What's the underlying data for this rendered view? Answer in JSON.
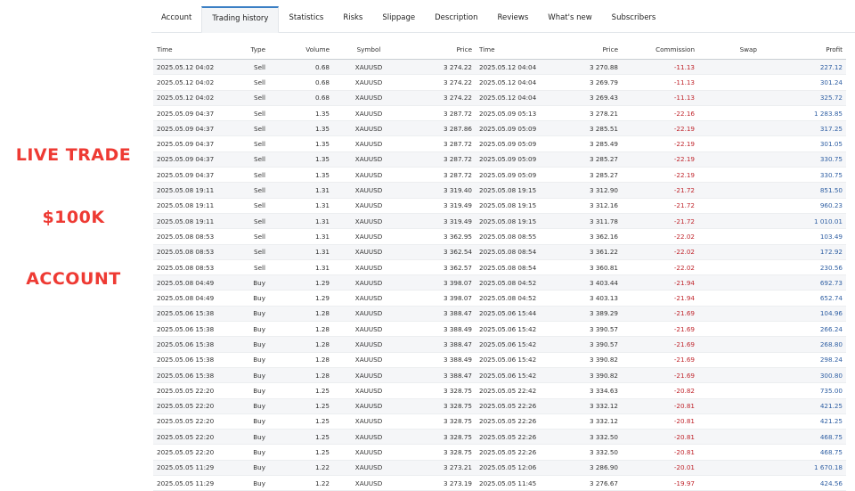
{
  "promo": {
    "line1": "LIVE TRADE",
    "line2": "$100K",
    "line3": "ACCOUNT",
    "color": "#ee3a33"
  },
  "tabs": [
    {
      "label": "Account"
    },
    {
      "label": "Trading history"
    },
    {
      "label": "Statistics"
    },
    {
      "label": "Risks"
    },
    {
      "label": "Slippage"
    },
    {
      "label": "Description"
    },
    {
      "label": "Reviews"
    },
    {
      "label": "What's new"
    },
    {
      "label": "Subscribers"
    }
  ],
  "active_tab": 1,
  "table": {
    "headers": [
      "Time",
      "Type",
      "Volume",
      "Symbol",
      "Price",
      "Time",
      "Price",
      "Commission",
      "Swap",
      "Profit"
    ],
    "rows": [
      [
        "2025.05.12 04:02",
        "Sell",
        "0.68",
        "XAUUSD",
        "3 274.22",
        "2025.05.12 04:04",
        "3 270.88",
        "-11.13",
        "",
        "227.12"
      ],
      [
        "2025.05.12 04:02",
        "Sell",
        "0.68",
        "XAUUSD",
        "3 274.22",
        "2025.05.12 04:04",
        "3 269.79",
        "-11.13",
        "",
        "301.24"
      ],
      [
        "2025.05.12 04:02",
        "Sell",
        "0.68",
        "XAUUSD",
        "3 274.22",
        "2025.05.12 04:04",
        "3 269.43",
        "-11.13",
        "",
        "325.72"
      ],
      [
        "2025.05.09 04:37",
        "Sell",
        "1.35",
        "XAUUSD",
        "3 287.72",
        "2025.05.09 05:13",
        "3 278.21",
        "-22.16",
        "",
        "1 283.85"
      ],
      [
        "2025.05.09 04:37",
        "Sell",
        "1.35",
        "XAUUSD",
        "3 287.86",
        "2025.05.09 05:09",
        "3 285.51",
        "-22.19",
        "",
        "317.25"
      ],
      [
        "2025.05.09 04:37",
        "Sell",
        "1.35",
        "XAUUSD",
        "3 287.72",
        "2025.05.09 05:09",
        "3 285.49",
        "-22.19",
        "",
        "301.05"
      ],
      [
        "2025.05.09 04:37",
        "Sell",
        "1.35",
        "XAUUSD",
        "3 287.72",
        "2025.05.09 05:09",
        "3 285.27",
        "-22.19",
        "",
        "330.75"
      ],
      [
        "2025.05.09 04:37",
        "Sell",
        "1.35",
        "XAUUSD",
        "3 287.72",
        "2025.05.09 05:09",
        "3 285.27",
        "-22.19",
        "",
        "330.75"
      ],
      [
        "2025.05.08 19:11",
        "Sell",
        "1.31",
        "XAUUSD",
        "3 319.40",
        "2025.05.08 19:15",
        "3 312.90",
        "-21.72",
        "",
        "851.50"
      ],
      [
        "2025.05.08 19:11",
        "Sell",
        "1.31",
        "XAUUSD",
        "3 319.49",
        "2025.05.08 19:15",
        "3 312.16",
        "-21.72",
        "",
        "960.23"
      ],
      [
        "2025.05.08 19:11",
        "Sell",
        "1.31",
        "XAUUSD",
        "3 319.49",
        "2025.05.08 19:15",
        "3 311.78",
        "-21.72",
        "",
        "1 010.01"
      ],
      [
        "2025.05.08 08:53",
        "Sell",
        "1.31",
        "XAUUSD",
        "3 362.95",
        "2025.05.08 08:55",
        "3 362.16",
        "-22.02",
        "",
        "103.49"
      ],
      [
        "2025.05.08 08:53",
        "Sell",
        "1.31",
        "XAUUSD",
        "3 362.54",
        "2025.05.08 08:54",
        "3 361.22",
        "-22.02",
        "",
        "172.92"
      ],
      [
        "2025.05.08 08:53",
        "Sell",
        "1.31",
        "XAUUSD",
        "3 362.57",
        "2025.05.08 08:54",
        "3 360.81",
        "-22.02",
        "",
        "230.56"
      ],
      [
        "2025.05.08 04:49",
        "Buy",
        "1.29",
        "XAUUSD",
        "3 398.07",
        "2025.05.08 04:52",
        "3 403.44",
        "-21.94",
        "",
        "692.73"
      ],
      [
        "2025.05.08 04:49",
        "Buy",
        "1.29",
        "XAUUSD",
        "3 398.07",
        "2025.05.08 04:52",
        "3 403.13",
        "-21.94",
        "",
        "652.74"
      ],
      [
        "2025.05.06 15:38",
        "Buy",
        "1.28",
        "XAUUSD",
        "3 388.47",
        "2025.05.06 15:44",
        "3 389.29",
        "-21.69",
        "",
        "104.96"
      ],
      [
        "2025.05.06 15:38",
        "Buy",
        "1.28",
        "XAUUSD",
        "3 388.49",
        "2025.05.06 15:42",
        "3 390.57",
        "-21.69",
        "",
        "266.24"
      ],
      [
        "2025.05.06 15:38",
        "Buy",
        "1.28",
        "XAUUSD",
        "3 388.47",
        "2025.05.06 15:42",
        "3 390.57",
        "-21.69",
        "",
        "268.80"
      ],
      [
        "2025.05.06 15:38",
        "Buy",
        "1.28",
        "XAUUSD",
        "3 388.49",
        "2025.05.06 15:42",
        "3 390.82",
        "-21.69",
        "",
        "298.24"
      ],
      [
        "2025.05.06 15:38",
        "Buy",
        "1.28",
        "XAUUSD",
        "3 388.47",
        "2025.05.06 15:42",
        "3 390.82",
        "-21.69",
        "",
        "300.80"
      ],
      [
        "2025.05.05 22:20",
        "Buy",
        "1.25",
        "XAUUSD",
        "3 328.75",
        "2025.05.05 22:42",
        "3 334.63",
        "-20.82",
        "",
        "735.00"
      ],
      [
        "2025.05.05 22:20",
        "Buy",
        "1.25",
        "XAUUSD",
        "3 328.75",
        "2025.05.05 22:26",
        "3 332.12",
        "-20.81",
        "",
        "421.25"
      ],
      [
        "2025.05.05 22:20",
        "Buy",
        "1.25",
        "XAUUSD",
        "3 328.75",
        "2025.05.05 22:26",
        "3 332.12",
        "-20.81",
        "",
        "421.25"
      ],
      [
        "2025.05.05 22:20",
        "Buy",
        "1.25",
        "XAUUSD",
        "3 328.75",
        "2025.05.05 22:26",
        "3 332.50",
        "-20.81",
        "",
        "468.75"
      ],
      [
        "2025.05.05 22:20",
        "Buy",
        "1.25",
        "XAUUSD",
        "3 328.75",
        "2025.05.05 22:26",
        "3 332.50",
        "-20.81",
        "",
        "468.75"
      ],
      [
        "2025.05.05 11:29",
        "Buy",
        "1.22",
        "XAUUSD",
        "3 273.21",
        "2025.05.05 12:06",
        "3 286.90",
        "-20.01",
        "",
        "1 670.18"
      ],
      [
        "2025.05.05 11:29",
        "Buy",
        "1.22",
        "XAUUSD",
        "3 273.19",
        "2025.05.05 11:45",
        "3 276.67",
        "-19.97",
        "",
        "424.56"
      ]
    ]
  },
  "colors": {
    "negative": "#c0262d",
    "positive": "#2f5fa3",
    "tab_accent": "#3a7fc4"
  }
}
